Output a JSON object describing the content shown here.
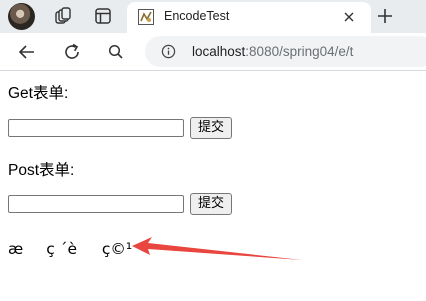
{
  "browser": {
    "tab_title": "EncodeTest",
    "url_host": "localhost",
    "url_rest": ":8080/spring04/e/t",
    "icons": [
      "avatar",
      "workspaces-icon",
      "tab-actions-icon",
      "favicon",
      "close-icon",
      "new-tab-icon",
      "back-icon",
      "refresh-icon",
      "search-icon",
      "info-icon"
    ]
  },
  "page": {
    "get_form": {
      "label": "Get表单:",
      "input_value": "",
      "submit_label": "提交"
    },
    "post_form": {
      "label": "Post表单:",
      "input_value": "",
      "submit_label": "提交"
    },
    "result_text": "æç ´èç©¹",
    "arrow_color": "#e8463f"
  }
}
